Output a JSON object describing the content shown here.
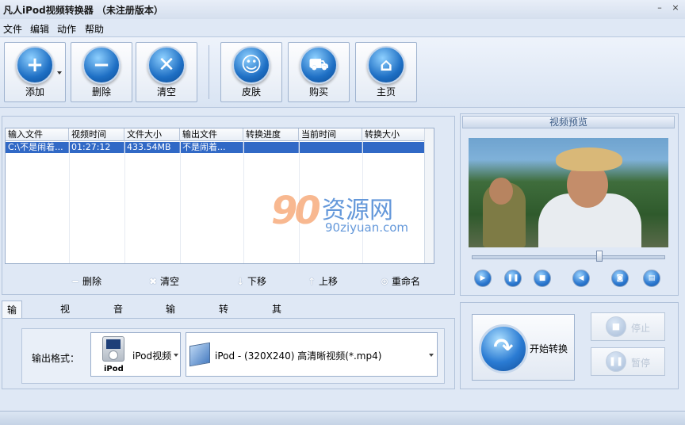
{
  "window": {
    "title": "凡人iPod视频转换器 （未注册版本）",
    "minimize": "–",
    "close": "×"
  },
  "menu": [
    "文件",
    "编辑",
    "动作",
    "帮助"
  ],
  "toolbar": {
    "add": "添加",
    "delete": "删除",
    "clear": "清空",
    "skin": "皮肤",
    "buy": "购买",
    "home": "主页"
  },
  "grid": {
    "columns": [
      "输入文件",
      "视频时间",
      "文件大小",
      "输出文件",
      "转换进度",
      "当前时间",
      "转换大小"
    ],
    "rows": [
      [
        "C:\\不是闹着...",
        "01:27:12",
        "433.54MB",
        "不是闹着...",
        "",
        "",
        ""
      ]
    ]
  },
  "watermark": {
    "number": "90",
    "brand": "资源网",
    "url": "90ziyuan.com"
  },
  "list_actions": {
    "delete": "删除",
    "clear": "清空",
    "down": "下移",
    "up": "上移",
    "rename": "重命名"
  },
  "tabs": [
    "输出格式",
    "视频参数",
    "音频参数",
    "输出目录",
    "转换设置",
    "其他设置"
  ],
  "format": {
    "label": "输出格式：",
    "device_icon_text": "iPod",
    "device": "iPod视频",
    "profile": "iPod - (320X240) 高清晰视频(*.mp4)"
  },
  "preview": {
    "title": "视频预览",
    "seek_fraction": 0.66
  },
  "convert": {
    "start": "开始转换",
    "stop": "停止",
    "pause": "暂停"
  },
  "colors": {
    "accent": "#2b77cf",
    "selection": "#3169c6"
  }
}
